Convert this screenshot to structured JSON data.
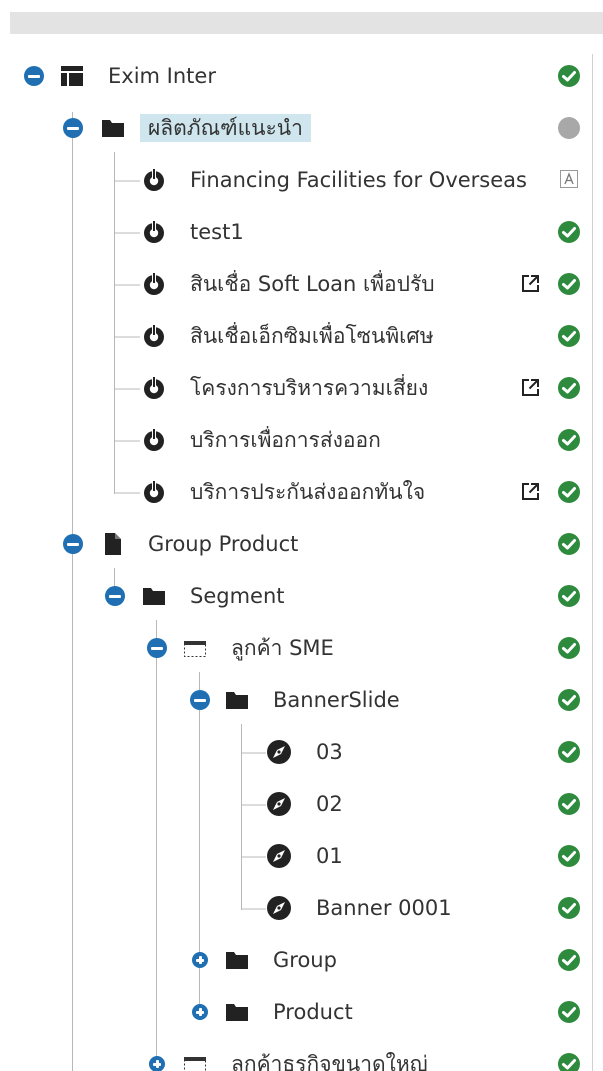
{
  "tree": [
    {
      "label": "Exim Inter",
      "icon": "layout-icon",
      "toggle": "minus",
      "status": "published"
    },
    {
      "label": "ผลิตภัณฑ์แนะนำ",
      "icon": "folder-icon",
      "toggle": "minus",
      "status": "unpublished",
      "selected": true
    },
    {
      "label": "Financing Facilities for Overseas",
      "icon": "power-icon",
      "toggle": "none",
      "status": "language"
    },
    {
      "label": "test1",
      "icon": "power-icon",
      "toggle": "none",
      "status": "published"
    },
    {
      "label": "สินเชื่อ Soft Loan เพื่อปรับ",
      "icon": "power-icon",
      "toggle": "none",
      "status": "published",
      "external": true
    },
    {
      "label": "สินเชื่อเอ็กซิมเพื่อโซนพิเศษ",
      "icon": "power-icon",
      "toggle": "none",
      "status": "published"
    },
    {
      "label": "โครงการบริหารความเสี่ยง",
      "icon": "power-icon",
      "toggle": "none",
      "status": "published",
      "external": true
    },
    {
      "label": "บริการเพื่อการส่งออก",
      "icon": "power-icon",
      "toggle": "none",
      "status": "published"
    },
    {
      "label": "บริการประกันส่งออกทันใจ",
      "icon": "power-icon",
      "toggle": "none",
      "status": "published",
      "external": true
    },
    {
      "label": "Group Product",
      "icon": "document-icon",
      "toggle": "minus",
      "status": "published"
    },
    {
      "label": "Segment",
      "icon": "folder-icon",
      "toggle": "minus",
      "status": "published"
    },
    {
      "label": "ลูกค้า SME",
      "icon": "section-icon",
      "toggle": "minus",
      "status": "published"
    },
    {
      "label": "BannerSlide",
      "icon": "folder-icon",
      "toggle": "minus",
      "status": "published"
    },
    {
      "label": "03",
      "icon": "compass-icon",
      "toggle": "none",
      "status": "published"
    },
    {
      "label": "02",
      "icon": "compass-icon",
      "toggle": "none",
      "status": "published"
    },
    {
      "label": "01",
      "icon": "compass-icon",
      "toggle": "none",
      "status": "published"
    },
    {
      "label": "Banner 0001",
      "icon": "compass-icon",
      "toggle": "none",
      "status": "published"
    },
    {
      "label": "Group",
      "icon": "folder-icon",
      "toggle": "plus",
      "status": "published"
    },
    {
      "label": "Product",
      "icon": "folder-icon",
      "toggle": "plus",
      "status": "published"
    },
    {
      "label": "ลูกค้าธุรกิจขนาดใหญ่",
      "icon": "section-icon",
      "toggle": "plus",
      "status": "published"
    }
  ],
  "colors": {
    "toggle": "#1f6fb2",
    "status_published": "#2e8b3e",
    "status_unpublished": "#a8a8a8",
    "selection": "#cfe6ee",
    "icon": "#222222"
  }
}
